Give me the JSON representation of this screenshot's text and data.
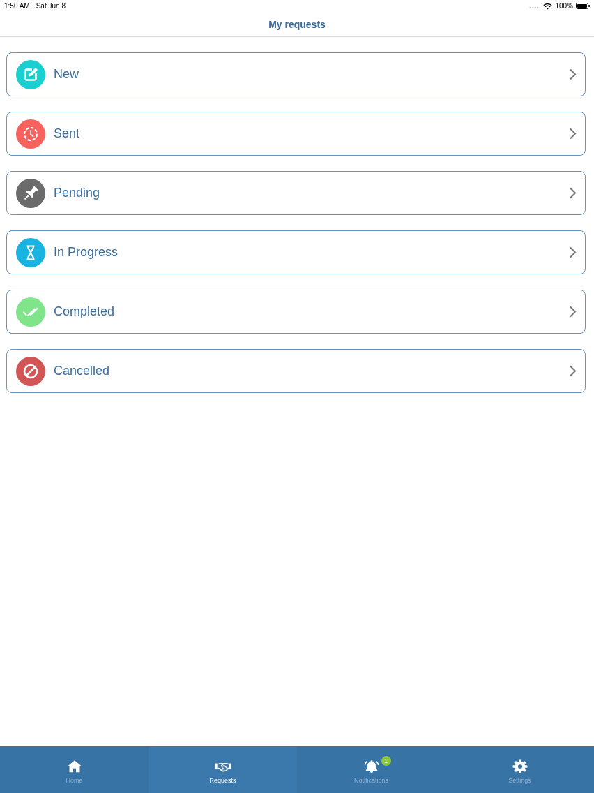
{
  "status_bar": {
    "time": "1:50 AM",
    "date": "Sat Jun 8",
    "battery": "100%"
  },
  "nav_bar": {
    "title": "My requests"
  },
  "requests": [
    {
      "label": "New",
      "kind": "new",
      "color": "#19cfcf"
    },
    {
      "label": "Sent",
      "kind": "sent",
      "color": "#f7625f"
    },
    {
      "label": "Pending",
      "kind": "pending",
      "color": "#6b6b6b"
    },
    {
      "label": "In Progress",
      "kind": "progress",
      "color": "#1ab4e2"
    },
    {
      "label": "Completed",
      "kind": "completed",
      "color": "#80e48a"
    },
    {
      "label": "Cancelled",
      "kind": "cancelled",
      "color": "#d25656"
    }
  ],
  "tab_bar": [
    {
      "label": "Home",
      "kind": "home",
      "selected": false
    },
    {
      "label": "Requests",
      "kind": "requests",
      "selected": true
    },
    {
      "label": "Notifications",
      "kind": "notifications",
      "selected": false,
      "badge": "1"
    },
    {
      "label": "Settings",
      "kind": "settings",
      "selected": false
    }
  ]
}
